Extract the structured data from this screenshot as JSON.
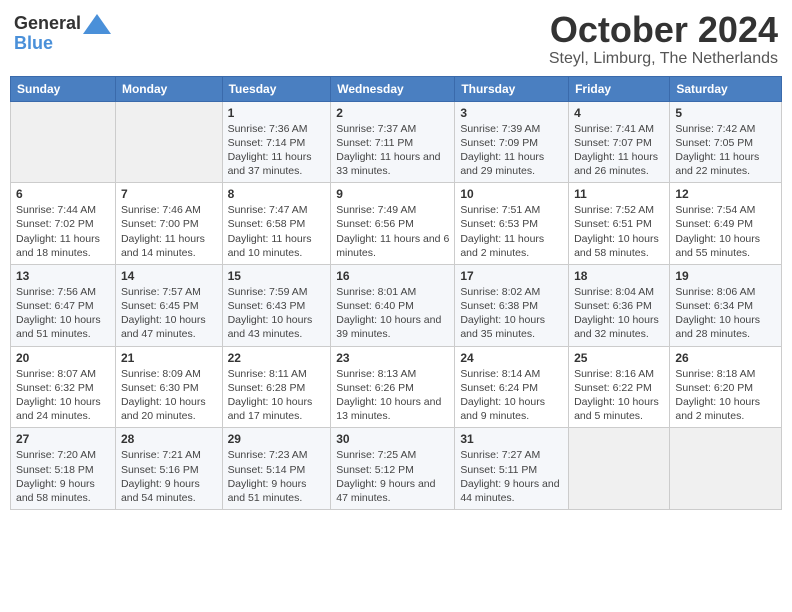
{
  "header": {
    "logo_general": "General",
    "logo_blue": "Blue",
    "month": "October 2024",
    "location": "Steyl, Limburg, The Netherlands"
  },
  "days_of_week": [
    "Sunday",
    "Monday",
    "Tuesday",
    "Wednesday",
    "Thursday",
    "Friday",
    "Saturday"
  ],
  "weeks": [
    [
      {
        "num": "",
        "info": ""
      },
      {
        "num": "",
        "info": ""
      },
      {
        "num": "1",
        "info": "Sunrise: 7:36 AM\nSunset: 7:14 PM\nDaylight: 11 hours\nand 37 minutes."
      },
      {
        "num": "2",
        "info": "Sunrise: 7:37 AM\nSunset: 7:11 PM\nDaylight: 11 hours\nand 33 minutes."
      },
      {
        "num": "3",
        "info": "Sunrise: 7:39 AM\nSunset: 7:09 PM\nDaylight: 11 hours\nand 29 minutes."
      },
      {
        "num": "4",
        "info": "Sunrise: 7:41 AM\nSunset: 7:07 PM\nDaylight: 11 hours\nand 26 minutes."
      },
      {
        "num": "5",
        "info": "Sunrise: 7:42 AM\nSunset: 7:05 PM\nDaylight: 11 hours\nand 22 minutes."
      }
    ],
    [
      {
        "num": "6",
        "info": "Sunrise: 7:44 AM\nSunset: 7:02 PM\nDaylight: 11 hours\nand 18 minutes."
      },
      {
        "num": "7",
        "info": "Sunrise: 7:46 AM\nSunset: 7:00 PM\nDaylight: 11 hours\nand 14 minutes."
      },
      {
        "num": "8",
        "info": "Sunrise: 7:47 AM\nSunset: 6:58 PM\nDaylight: 11 hours\nand 10 minutes."
      },
      {
        "num": "9",
        "info": "Sunrise: 7:49 AM\nSunset: 6:56 PM\nDaylight: 11 hours\nand 6 minutes."
      },
      {
        "num": "10",
        "info": "Sunrise: 7:51 AM\nSunset: 6:53 PM\nDaylight: 11 hours\nand 2 minutes."
      },
      {
        "num": "11",
        "info": "Sunrise: 7:52 AM\nSunset: 6:51 PM\nDaylight: 10 hours\nand 58 minutes."
      },
      {
        "num": "12",
        "info": "Sunrise: 7:54 AM\nSunset: 6:49 PM\nDaylight: 10 hours\nand 55 minutes."
      }
    ],
    [
      {
        "num": "13",
        "info": "Sunrise: 7:56 AM\nSunset: 6:47 PM\nDaylight: 10 hours\nand 51 minutes."
      },
      {
        "num": "14",
        "info": "Sunrise: 7:57 AM\nSunset: 6:45 PM\nDaylight: 10 hours\nand 47 minutes."
      },
      {
        "num": "15",
        "info": "Sunrise: 7:59 AM\nSunset: 6:43 PM\nDaylight: 10 hours\nand 43 minutes."
      },
      {
        "num": "16",
        "info": "Sunrise: 8:01 AM\nSunset: 6:40 PM\nDaylight: 10 hours\nand 39 minutes."
      },
      {
        "num": "17",
        "info": "Sunrise: 8:02 AM\nSunset: 6:38 PM\nDaylight: 10 hours\nand 35 minutes."
      },
      {
        "num": "18",
        "info": "Sunrise: 8:04 AM\nSunset: 6:36 PM\nDaylight: 10 hours\nand 32 minutes."
      },
      {
        "num": "19",
        "info": "Sunrise: 8:06 AM\nSunset: 6:34 PM\nDaylight: 10 hours\nand 28 minutes."
      }
    ],
    [
      {
        "num": "20",
        "info": "Sunrise: 8:07 AM\nSunset: 6:32 PM\nDaylight: 10 hours\nand 24 minutes."
      },
      {
        "num": "21",
        "info": "Sunrise: 8:09 AM\nSunset: 6:30 PM\nDaylight: 10 hours\nand 20 minutes."
      },
      {
        "num": "22",
        "info": "Sunrise: 8:11 AM\nSunset: 6:28 PM\nDaylight: 10 hours\nand 17 minutes."
      },
      {
        "num": "23",
        "info": "Sunrise: 8:13 AM\nSunset: 6:26 PM\nDaylight: 10 hours\nand 13 minutes."
      },
      {
        "num": "24",
        "info": "Sunrise: 8:14 AM\nSunset: 6:24 PM\nDaylight: 10 hours\nand 9 minutes."
      },
      {
        "num": "25",
        "info": "Sunrise: 8:16 AM\nSunset: 6:22 PM\nDaylight: 10 hours\nand 5 minutes."
      },
      {
        "num": "26",
        "info": "Sunrise: 8:18 AM\nSunset: 6:20 PM\nDaylight: 10 hours\nand 2 minutes."
      }
    ],
    [
      {
        "num": "27",
        "info": "Sunrise: 7:20 AM\nSunset: 5:18 PM\nDaylight: 9 hours\nand 58 minutes."
      },
      {
        "num": "28",
        "info": "Sunrise: 7:21 AM\nSunset: 5:16 PM\nDaylight: 9 hours\nand 54 minutes."
      },
      {
        "num": "29",
        "info": "Sunrise: 7:23 AM\nSunset: 5:14 PM\nDaylight: 9 hours\nand 51 minutes."
      },
      {
        "num": "30",
        "info": "Sunrise: 7:25 AM\nSunset: 5:12 PM\nDaylight: 9 hours\nand 47 minutes."
      },
      {
        "num": "31",
        "info": "Sunrise: 7:27 AM\nSunset: 5:11 PM\nDaylight: 9 hours\nand 44 minutes."
      },
      {
        "num": "",
        "info": ""
      },
      {
        "num": "",
        "info": ""
      }
    ]
  ]
}
